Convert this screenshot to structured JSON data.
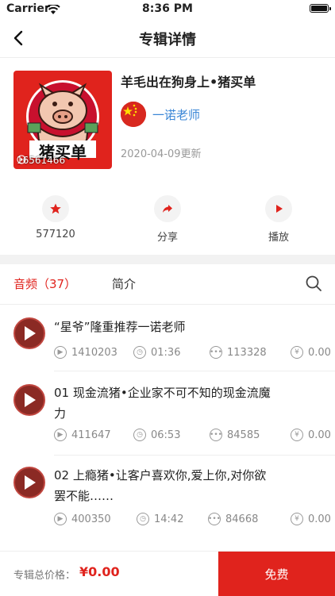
{
  "status_bar": {
    "carrier": "Carrier",
    "time": "8:36 PM"
  },
  "nav": {
    "title": "专辑详情"
  },
  "album": {
    "title": "羊毛出在狗身上•猪买单",
    "play_count": "16561466",
    "cover_text": "猪买单",
    "author": "一诺老师",
    "updated": "2020-04-09更新"
  },
  "actions": {
    "favorite_count": "577120",
    "share_label": "分享",
    "play_label": "播放"
  },
  "tabs": {
    "audio_label": "音频（37）",
    "intro_label": "简介"
  },
  "tracks": [
    {
      "title": "“星爷”隆重推荐一诺老师",
      "plays": "1410203",
      "duration": "01:36",
      "comments": "113328",
      "price": "0.00"
    },
    {
      "title": "01 现金流猪•企业家不可不知的现金流魔力",
      "plays": "411647",
      "duration": "06:53",
      "comments": "84585",
      "price": "0.00"
    },
    {
      "title": "02 上瘾猪•让客户喜欢你,爱上你,对你欲罢不能……",
      "plays": "400350",
      "duration": "14:42",
      "comments": "84668",
      "price": "0.00"
    }
  ],
  "bottom": {
    "price_label": "专辑总价格：",
    "price": "¥0.00",
    "free_label": "免费"
  },
  "colors": {
    "accent": "#e0231d",
    "link": "#3a86d6"
  }
}
